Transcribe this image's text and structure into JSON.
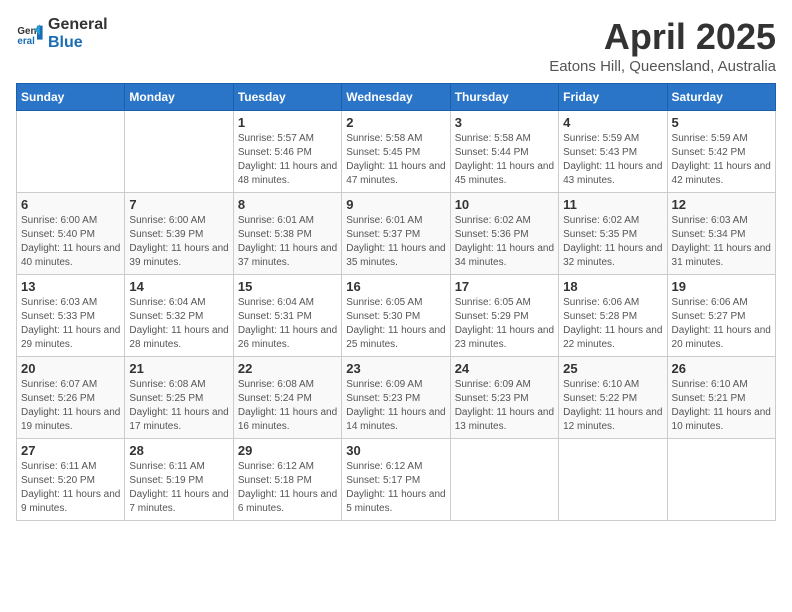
{
  "logo": {
    "general": "General",
    "blue": "Blue"
  },
  "title": "April 2025",
  "location": "Eatons Hill, Queensland, Australia",
  "weekdays": [
    "Sunday",
    "Monday",
    "Tuesday",
    "Wednesday",
    "Thursday",
    "Friday",
    "Saturday"
  ],
  "weeks": [
    [
      {
        "day": "",
        "info": ""
      },
      {
        "day": "",
        "info": ""
      },
      {
        "day": "1",
        "info": "Sunrise: 5:57 AM\nSunset: 5:46 PM\nDaylight: 11 hours and 48 minutes."
      },
      {
        "day": "2",
        "info": "Sunrise: 5:58 AM\nSunset: 5:45 PM\nDaylight: 11 hours and 47 minutes."
      },
      {
        "day": "3",
        "info": "Sunrise: 5:58 AM\nSunset: 5:44 PM\nDaylight: 11 hours and 45 minutes."
      },
      {
        "day": "4",
        "info": "Sunrise: 5:59 AM\nSunset: 5:43 PM\nDaylight: 11 hours and 43 minutes."
      },
      {
        "day": "5",
        "info": "Sunrise: 5:59 AM\nSunset: 5:42 PM\nDaylight: 11 hours and 42 minutes."
      }
    ],
    [
      {
        "day": "6",
        "info": "Sunrise: 6:00 AM\nSunset: 5:40 PM\nDaylight: 11 hours and 40 minutes."
      },
      {
        "day": "7",
        "info": "Sunrise: 6:00 AM\nSunset: 5:39 PM\nDaylight: 11 hours and 39 minutes."
      },
      {
        "day": "8",
        "info": "Sunrise: 6:01 AM\nSunset: 5:38 PM\nDaylight: 11 hours and 37 minutes."
      },
      {
        "day": "9",
        "info": "Sunrise: 6:01 AM\nSunset: 5:37 PM\nDaylight: 11 hours and 35 minutes."
      },
      {
        "day": "10",
        "info": "Sunrise: 6:02 AM\nSunset: 5:36 PM\nDaylight: 11 hours and 34 minutes."
      },
      {
        "day": "11",
        "info": "Sunrise: 6:02 AM\nSunset: 5:35 PM\nDaylight: 11 hours and 32 minutes."
      },
      {
        "day": "12",
        "info": "Sunrise: 6:03 AM\nSunset: 5:34 PM\nDaylight: 11 hours and 31 minutes."
      }
    ],
    [
      {
        "day": "13",
        "info": "Sunrise: 6:03 AM\nSunset: 5:33 PM\nDaylight: 11 hours and 29 minutes."
      },
      {
        "day": "14",
        "info": "Sunrise: 6:04 AM\nSunset: 5:32 PM\nDaylight: 11 hours and 28 minutes."
      },
      {
        "day": "15",
        "info": "Sunrise: 6:04 AM\nSunset: 5:31 PM\nDaylight: 11 hours and 26 minutes."
      },
      {
        "day": "16",
        "info": "Sunrise: 6:05 AM\nSunset: 5:30 PM\nDaylight: 11 hours and 25 minutes."
      },
      {
        "day": "17",
        "info": "Sunrise: 6:05 AM\nSunset: 5:29 PM\nDaylight: 11 hours and 23 minutes."
      },
      {
        "day": "18",
        "info": "Sunrise: 6:06 AM\nSunset: 5:28 PM\nDaylight: 11 hours and 22 minutes."
      },
      {
        "day": "19",
        "info": "Sunrise: 6:06 AM\nSunset: 5:27 PM\nDaylight: 11 hours and 20 minutes."
      }
    ],
    [
      {
        "day": "20",
        "info": "Sunrise: 6:07 AM\nSunset: 5:26 PM\nDaylight: 11 hours and 19 minutes."
      },
      {
        "day": "21",
        "info": "Sunrise: 6:08 AM\nSunset: 5:25 PM\nDaylight: 11 hours and 17 minutes."
      },
      {
        "day": "22",
        "info": "Sunrise: 6:08 AM\nSunset: 5:24 PM\nDaylight: 11 hours and 16 minutes."
      },
      {
        "day": "23",
        "info": "Sunrise: 6:09 AM\nSunset: 5:23 PM\nDaylight: 11 hours and 14 minutes."
      },
      {
        "day": "24",
        "info": "Sunrise: 6:09 AM\nSunset: 5:23 PM\nDaylight: 11 hours and 13 minutes."
      },
      {
        "day": "25",
        "info": "Sunrise: 6:10 AM\nSunset: 5:22 PM\nDaylight: 11 hours and 12 minutes."
      },
      {
        "day": "26",
        "info": "Sunrise: 6:10 AM\nSunset: 5:21 PM\nDaylight: 11 hours and 10 minutes."
      }
    ],
    [
      {
        "day": "27",
        "info": "Sunrise: 6:11 AM\nSunset: 5:20 PM\nDaylight: 11 hours and 9 minutes."
      },
      {
        "day": "28",
        "info": "Sunrise: 6:11 AM\nSunset: 5:19 PM\nDaylight: 11 hours and 7 minutes."
      },
      {
        "day": "29",
        "info": "Sunrise: 6:12 AM\nSunset: 5:18 PM\nDaylight: 11 hours and 6 minutes."
      },
      {
        "day": "30",
        "info": "Sunrise: 6:12 AM\nSunset: 5:17 PM\nDaylight: 11 hours and 5 minutes."
      },
      {
        "day": "",
        "info": ""
      },
      {
        "day": "",
        "info": ""
      },
      {
        "day": "",
        "info": ""
      }
    ]
  ]
}
